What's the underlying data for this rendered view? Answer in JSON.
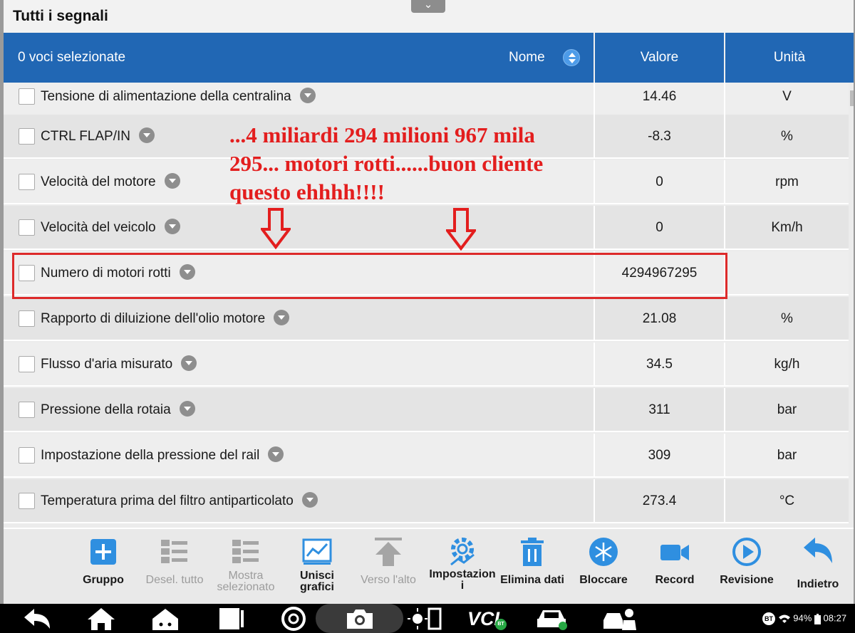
{
  "window": {
    "title": "Tutti i segnali",
    "pull_tab_glyph": "⌄"
  },
  "header": {
    "selected_count": "0 voci selezionate",
    "name_col": "Nome",
    "value_col": "Valore",
    "unit_col": "Unità"
  },
  "rows": [
    {
      "name": "Tensione di alimentazione della centralina",
      "value": "14.46",
      "unit": "V"
    },
    {
      "name": "CTRL FLAP/IN",
      "value": "-8.3",
      "unit": "%"
    },
    {
      "name": "Velocità del motore",
      "value": "0",
      "unit": "rpm"
    },
    {
      "name": "Velocità del veicolo",
      "value": "0",
      "unit": "Km/h"
    },
    {
      "name": "Numero di motori rotti",
      "value": "4294967295",
      "unit": ""
    },
    {
      "name": "Rapporto di diluizione dell'olio motore",
      "value": "21.08",
      "unit": "%"
    },
    {
      "name": "Flusso d'aria misurato",
      "value": "34.5",
      "unit": "kg/h"
    },
    {
      "name": "Pressione della rotaia",
      "value": "311",
      "unit": "bar"
    },
    {
      "name": "Impostazione della pressione del rail",
      "value": "309",
      "unit": "bar"
    },
    {
      "name": "Temperatura prima del filtro antiparticolato",
      "value": "273.4",
      "unit": "°C"
    }
  ],
  "annotation": {
    "line1": "...4 miliardi 294 milioni 967 mila",
    "line2": "295... motori rotti......buon cliente",
    "line3": "questo ehhhh!!!!",
    "color": "#e31e1e"
  },
  "toolbar": {
    "gruppo": "Gruppo",
    "desel_tutto": "Desel. tutto",
    "mostra_l1": "Mostra",
    "mostra_l2": "selezionato",
    "unisci_l1": "Unisci",
    "unisci_l2": "grafici",
    "verso_alto": "Verso l'alto",
    "impost_l1": "Impostazion",
    "impost_l2": "i",
    "elimina": "Elimina dati",
    "bloccare": "Bloccare",
    "record": "Record",
    "revisione": "Revisione",
    "indietro": "Indietro"
  },
  "navbar": {
    "vci_label": "VCI",
    "bt_badge": "BT",
    "status_bt": "BT",
    "battery": "94%",
    "time": "08:27"
  },
  "colors": {
    "accent": "#2167b4",
    "toolbar_icon": "#2f8fe0",
    "highlight": "#dd2a2a"
  }
}
